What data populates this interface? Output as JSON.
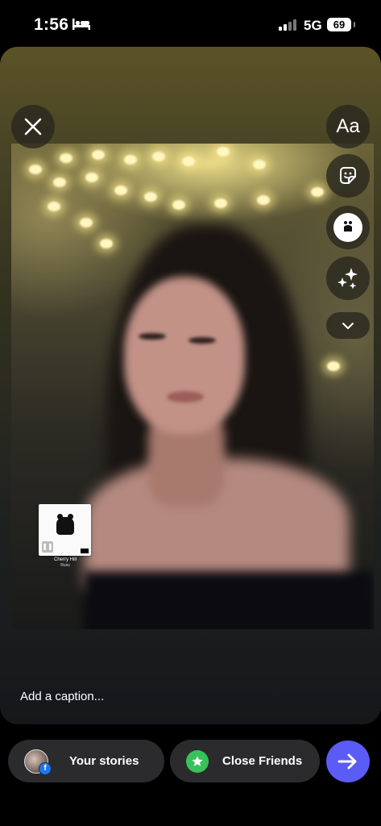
{
  "status_bar": {
    "time": "1:56",
    "network": "5G",
    "battery": "69"
  },
  "music_sticker": {
    "song": "Cherry Hill",
    "artist": "Russ"
  },
  "tools": {
    "text_label": "Aa"
  },
  "caption": {
    "placeholder": "Add a caption..."
  },
  "share": {
    "your_stories_label": "Your stories",
    "close_friends_label": "Close Friends"
  },
  "colors": {
    "send_button": "#5b5bf5",
    "close_friends_badge": "#38c25a",
    "facebook_badge": "#1877f2"
  },
  "icons": [
    "bed-icon",
    "close-icon",
    "sticker-icon",
    "music-icon",
    "effects-icon",
    "chevron-down-icon",
    "star-icon",
    "arrow-right-icon"
  ]
}
